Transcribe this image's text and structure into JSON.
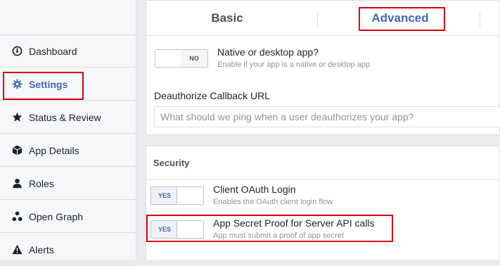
{
  "sidebar": {
    "items": [
      {
        "label": "Dashboard",
        "icon": "dashboard-icon"
      },
      {
        "label": "Settings",
        "icon": "gear-icon"
      },
      {
        "label": "Status & Review",
        "icon": "star-icon"
      },
      {
        "label": "App Details",
        "icon": "cube-icon"
      },
      {
        "label": "Roles",
        "icon": "person-icon"
      },
      {
        "label": "Open Graph",
        "icon": "graph-nodes-icon"
      },
      {
        "label": "Alerts",
        "icon": "warning-icon"
      }
    ]
  },
  "tabs": {
    "basic": "Basic",
    "advanced": "Advanced"
  },
  "native_app": {
    "toggle": "NO",
    "title": "Native or desktop app?",
    "desc": "Enable if your app is a native or desktop app"
  },
  "deauthorize": {
    "label": "Deauthorize Callback URL",
    "placeholder": "What should we ping when a user deauthorizes your app?",
    "value": ""
  },
  "security": {
    "heading": "Security",
    "client_oauth": {
      "toggle": "YES",
      "title": "Client OAuth Login",
      "desc": "Enables the OAuth client login flow"
    },
    "app_secret_proof": {
      "toggle": "YES",
      "title": "App Secret Proof for Server API calls",
      "desc": "App must submit a proof of app secret"
    }
  },
  "colors": {
    "accent": "#4267b2",
    "highlight_box": "#d8000c",
    "background": "#e9ebee"
  }
}
